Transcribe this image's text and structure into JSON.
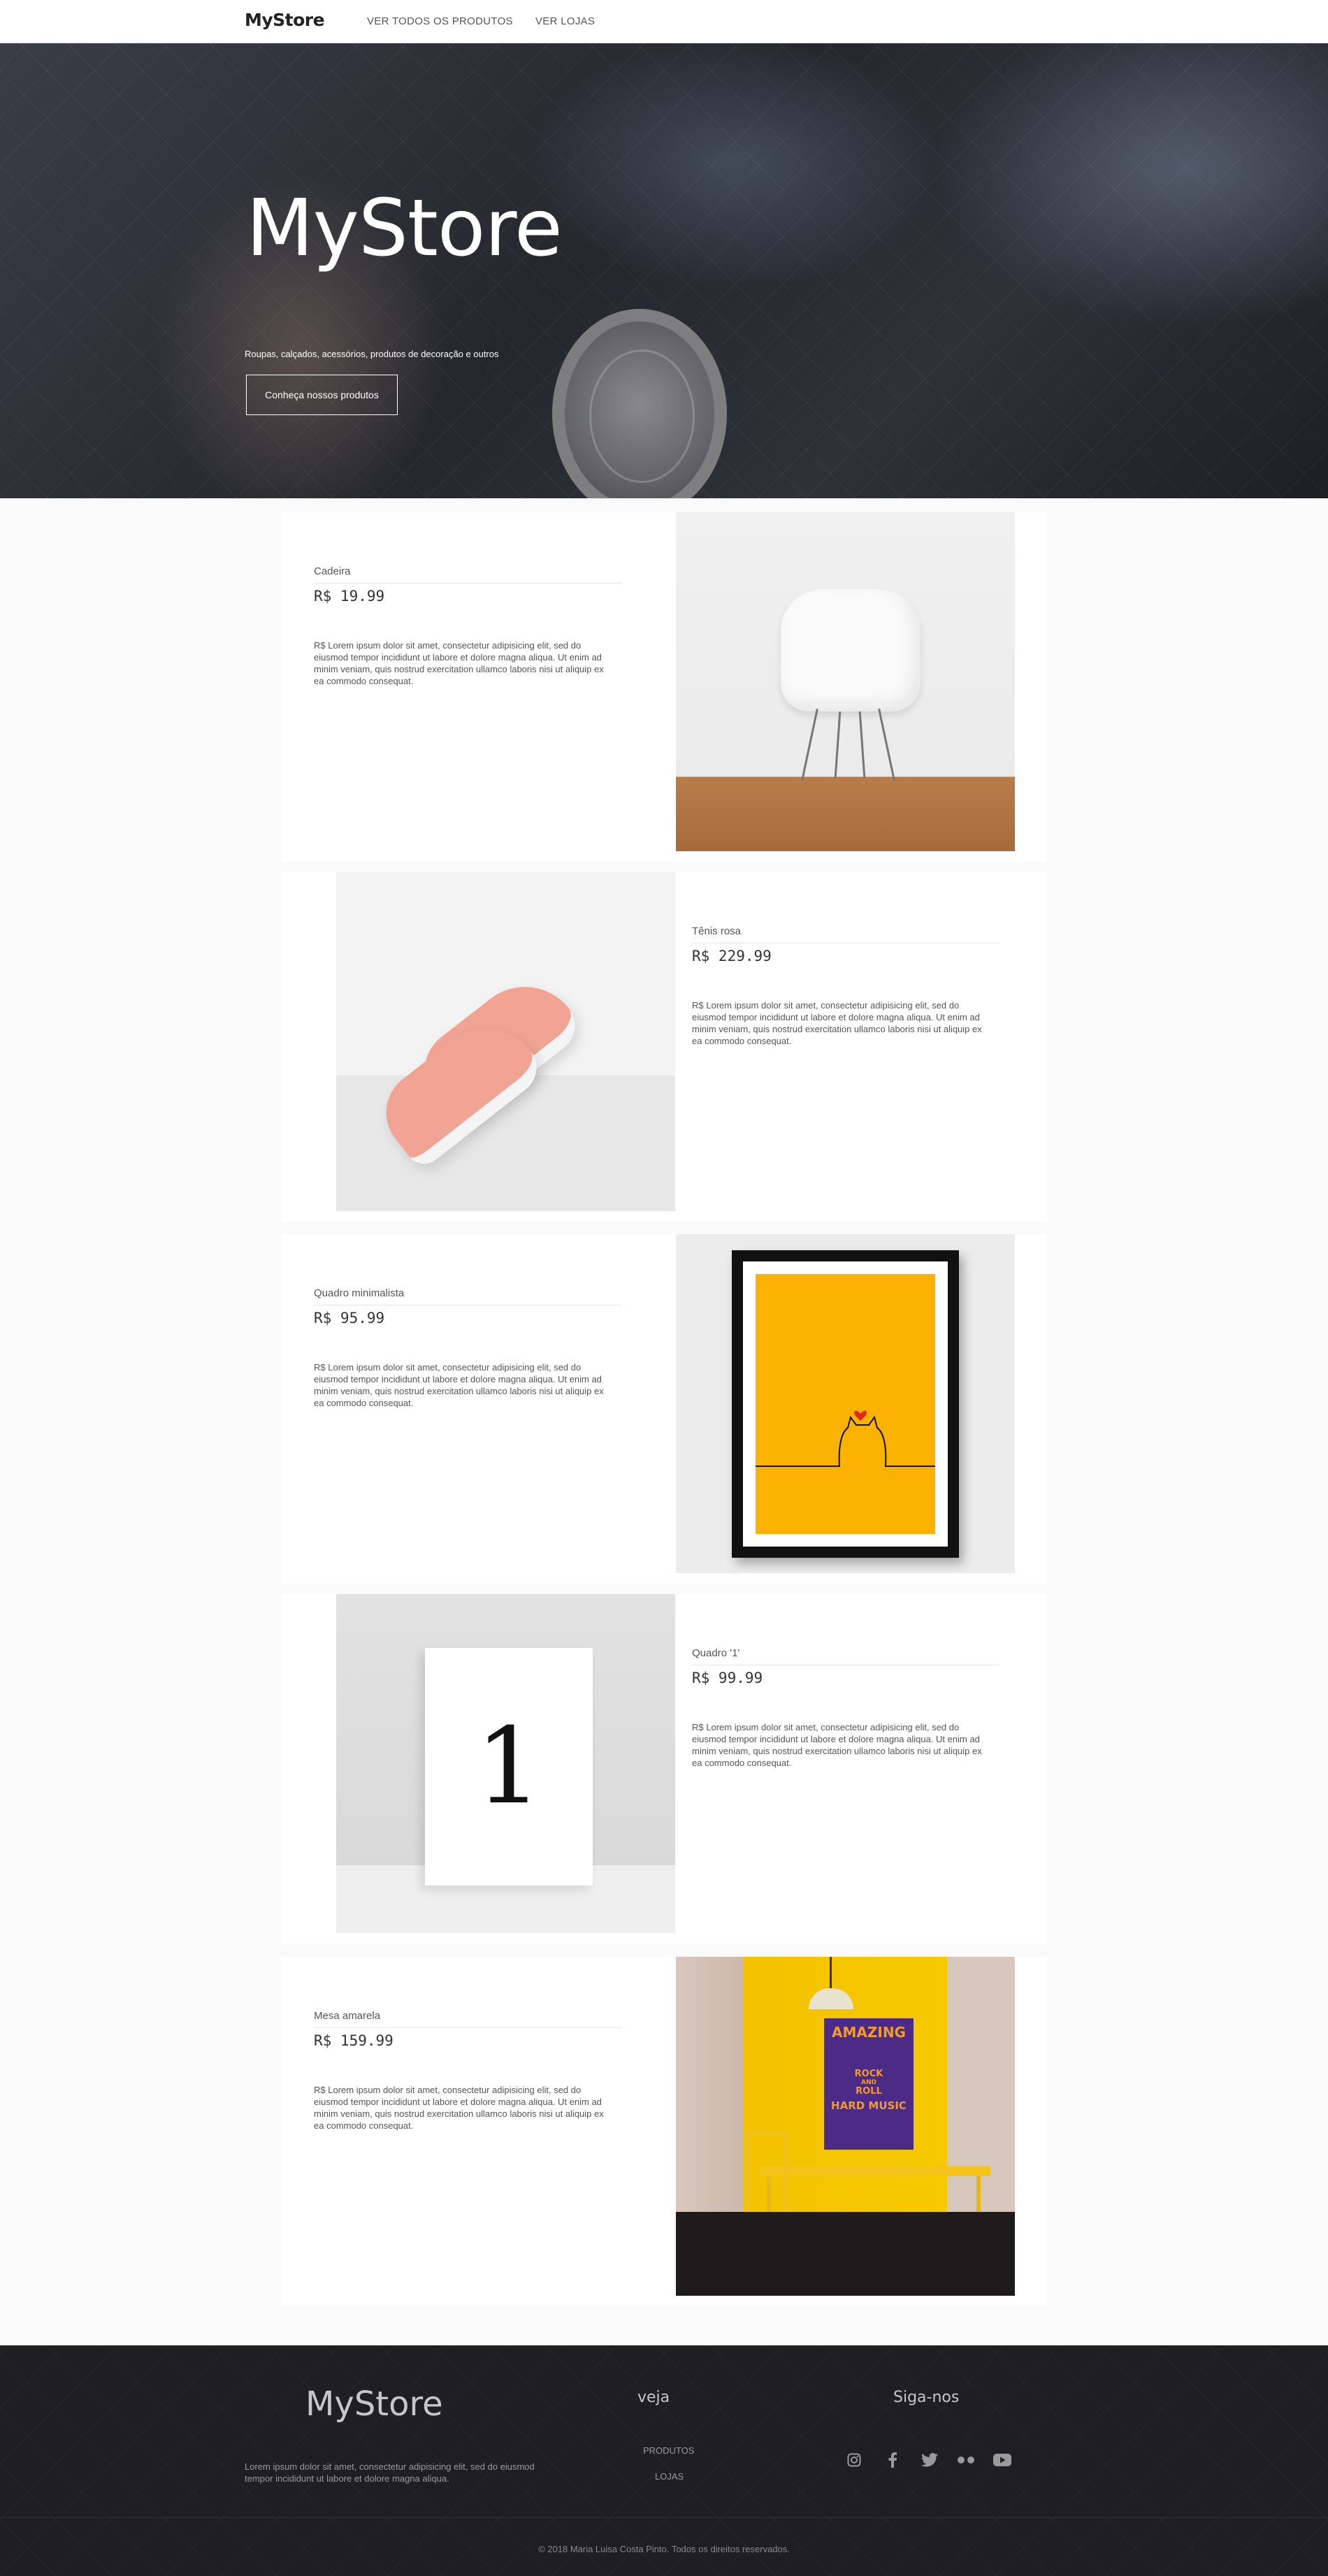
{
  "nav": {
    "logo": "MyStore",
    "links": [
      "VER TODOS OS PRODUTOS",
      "VER LOJAS"
    ]
  },
  "hero": {
    "title": "MyStore",
    "subtitle": "Roupas, calçados, acessórios, produtos de decoração e outros",
    "button": "Conheça nossos produtos"
  },
  "products": [
    {
      "name": "Cadeira",
      "price": "R$ 19.99",
      "description": "R$ Lorem ipsum dolor sit amet, consectetur adipisicing elit, sed do eiusmod tempor incididunt ut labore et dolore magna aliqua. Ut enim ad minim veniam, quis nostrud exercitation ullamco laboris nisi ut aliquip ex ea commodo consequat."
    },
    {
      "name": "Tênis rosa",
      "price": "R$ 229.99",
      "description": "R$ Lorem ipsum dolor sit amet, consectetur adipisicing elit, sed do eiusmod tempor incididunt ut labore et dolore magna aliqua. Ut enim ad minim veniam, quis nostrud exercitation ullamco laboris nisi ut aliquip ex ea commodo consequat."
    },
    {
      "name": "Quadro minimalista",
      "price": "R$ 95.99",
      "description": "R$ Lorem ipsum dolor sit amet, consectetur adipisicing elit, sed do eiusmod tempor incididunt ut labore et dolore magna aliqua. Ut enim ad minim veniam, quis nostrud exercitation ullamco laboris nisi ut aliquip ex ea commodo consequat."
    },
    {
      "name": "Quadro '1'",
      "price": "R$ 99.99",
      "description": "R$ Lorem ipsum dolor sit amet, consectetur adipisicing elit, sed do eiusmod tempor incididunt ut labore et dolore magna aliqua. Ut enim ad minim veniam, quis nostrud exercitation ullamco laboris nisi ut aliquip ex ea commodo consequat.",
      "art_text": "1"
    },
    {
      "name": "Mesa amarela",
      "price": "R$ 159.99",
      "description": "R$ Lorem ipsum dolor sit amet, consectetur adipisicing elit, sed do eiusmod tempor incididunt ut labore et dolore magna aliqua. Ut enim ad minim veniam, quis nostrud exercitation ullamco laboris nisi ut aliquip ex ea commodo consequat.",
      "poster_lines": [
        "AMAZING",
        "ROCK",
        "AND",
        "ROLL",
        "HARD MUSIC"
      ]
    }
  ],
  "footer": {
    "logo": "MyStore",
    "description": "Lorem ipsum dolor sit amet, consectetur adipisicing elit, sed do eiusmod tempor incididunt ut labore et dolore magna aliqua.",
    "veja_title": "veja",
    "veja_links": [
      "PRODUTOS",
      "LOJAS"
    ],
    "siga_title": "Siga-nos",
    "social": [
      "instagram-icon",
      "facebook-icon",
      "twitter-icon",
      "flickr-icon",
      "youtube-icon"
    ],
    "copyright": "© 2018 Maria Luisa Costa Pinto. Todos os direitos reservados."
  },
  "colors": {
    "accent_yellow": "#fbb203",
    "footer_bg": "#1f1f21",
    "shoe_pink": "#f1a494"
  }
}
